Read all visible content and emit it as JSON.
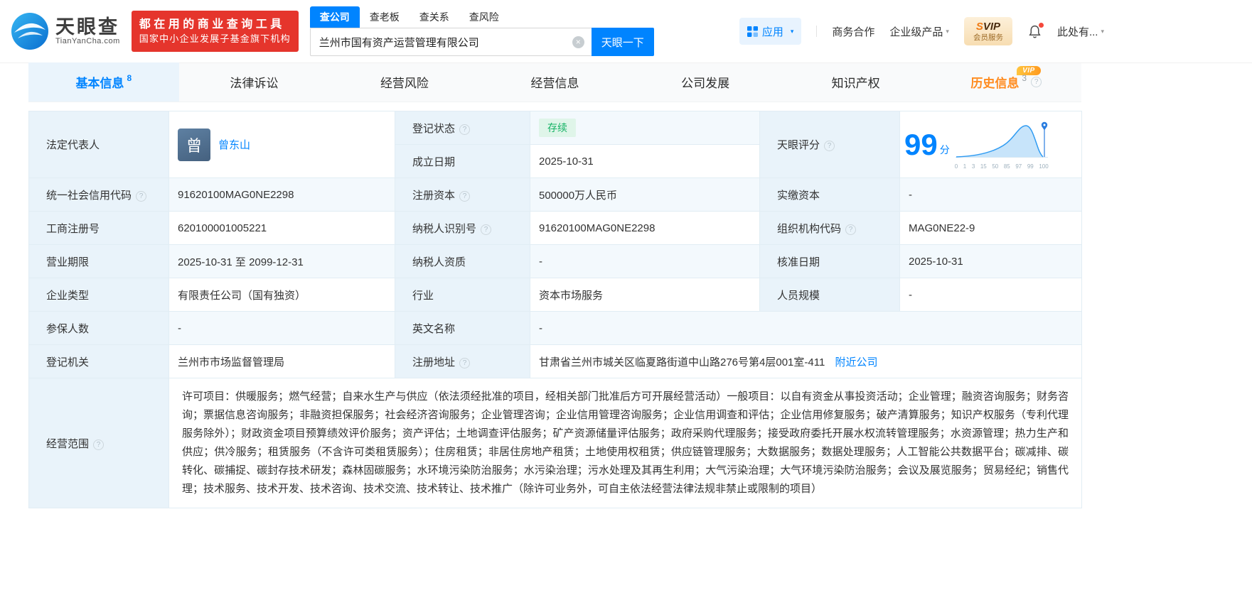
{
  "colors": {
    "primary": "#0084ff",
    "status_green": "#14b264",
    "history_orange": "#ff8b1f",
    "promo_red": "#e5352c"
  },
  "icons": {
    "help": "?",
    "caret": "▾",
    "clear": "×"
  },
  "header": {
    "logo": {
      "brand": "天眼查",
      "domain": "TianYanCha.com"
    },
    "promo": {
      "line1": "都在用的商业查询工具",
      "line2": "国家中小企业发展子基金旗下机构"
    },
    "search": {
      "tabs": [
        "查公司",
        "查老板",
        "查关系",
        "查风险"
      ],
      "value": "兰州市国有资产运营管理有限公司",
      "button": "天眼一下"
    },
    "nav": {
      "apps": "应用",
      "cooperation": "商务合作",
      "enterprise": "企业级产品",
      "svip_title": "SVIP",
      "svip_sub": "会员服务",
      "more": "此处有..."
    }
  },
  "tabs": {
    "basic": {
      "label": "基本信息",
      "count": "8"
    },
    "legal": {
      "label": "法律诉讼"
    },
    "risk": {
      "label": "经营风险"
    },
    "operation": {
      "label": "经营信息"
    },
    "development": {
      "label": "公司发展"
    },
    "ip": {
      "label": "知识产权"
    },
    "history": {
      "label": "历史信息",
      "count": "3",
      "vip": "VIP"
    }
  },
  "info": {
    "legal_rep": {
      "label": "法定代表人",
      "avatar": "曾",
      "name": "曾东山"
    },
    "reg_status": {
      "label": "登记状态",
      "value": "存续"
    },
    "establish_date": {
      "label": "成立日期",
      "value": "2025-10-31"
    },
    "score": {
      "label": "天眼评分",
      "value": "99",
      "unit": "分",
      "axis": [
        "0",
        "1",
        "3",
        "15",
        "50",
        "85",
        "97",
        "99",
        "100"
      ]
    },
    "credit_code": {
      "label": "统一社会信用代码",
      "value": "91620100MAG0NE2298"
    },
    "reg_capital": {
      "label": "注册资本",
      "value": "500000万人民币"
    },
    "paid_capital": {
      "label": "实缴资本",
      "value": "-"
    },
    "reg_number": {
      "label": "工商注册号",
      "value": "620100001005221"
    },
    "taxpayer_id": {
      "label": "纳税人识别号",
      "value": "91620100MAG0NE2298"
    },
    "org_code": {
      "label": "组织机构代码",
      "value": "MAG0NE22-9"
    },
    "business_term": {
      "label": "营业期限",
      "value": "2025-10-31 至 2099-12-31"
    },
    "taxpayer_quality": {
      "label": "纳税人资质",
      "value": "-"
    },
    "approval_date": {
      "label": "核准日期",
      "value": "2025-10-31"
    },
    "company_type": {
      "label": "企业类型",
      "value": "有限责任公司（国有独资）"
    },
    "industry": {
      "label": "行业",
      "value": "资本市场服务"
    },
    "staff_size": {
      "label": "人员规模",
      "value": "-"
    },
    "insured_count": {
      "label": "参保人数",
      "value": "-"
    },
    "english_name": {
      "label": "英文名称",
      "value": "-"
    },
    "reg_authority": {
      "label": "登记机关",
      "value": "兰州市市场监督管理局"
    },
    "reg_address": {
      "label": "注册地址",
      "value": "甘肃省兰州市城关区临夏路街道中山路276号第4层001室-411",
      "link": "附近公司"
    },
    "business_scope": {
      "label": "经营范围",
      "value": "许可项目：供暖服务；燃气经营；自来水生产与供应（依法须经批准的项目，经相关部门批准后方可开展经营活动）一般项目：以自有资金从事投资活动；企业管理；融资咨询服务；财务咨询；票据信息咨询服务；非融资担保服务；社会经济咨询服务；企业管理咨询；企业信用管理咨询服务；企业信用调查和评估；企业信用修复服务；破产清算服务；知识产权服务（专利代理服务除外）；财政资金项目预算绩效评价服务；资产评估；土地调查评估服务；矿产资源储量评估服务；政府采购代理服务；接受政府委托开展水权流转管理服务；水资源管理；热力生产和供应；供冷服务；租赁服务（不含许可类租赁服务）；住房租赁；非居住房地产租赁；土地使用权租赁；供应链管理服务；大数据服务；数据处理服务；人工智能公共数据平台；碳减排、碳转化、碳捕捉、碳封存技术研发；森林固碳服务；水环境污染防治服务；水污染治理；污水处理及其再生利用；大气污染治理；大气环境污染防治服务；会议及展览服务；贸易经纪；销售代理；技术服务、技术开发、技术咨询、技术交流、技术转让、技术推广（除许可业务外，可自主依法经营法律法规非禁止或限制的项目）"
    }
  }
}
